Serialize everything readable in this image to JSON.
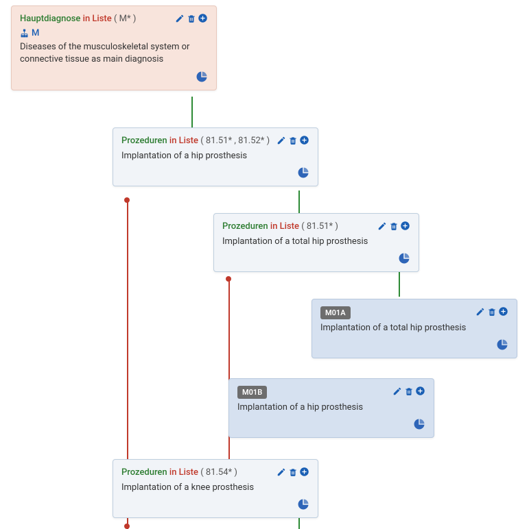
{
  "nodes": {
    "root": {
      "label_green": "Hauptdiagnose",
      "label_red": "in Liste",
      "label_grey": "( M* )",
      "meta_code": "M",
      "desc": "Diseases of the musculoskeletal system or connective tissue as main diagnosis"
    },
    "proc1": {
      "label_green": "Prozeduren",
      "label_red": "in Liste",
      "label_grey": "( 81.51* , 81.52* )",
      "desc": "Implantation of a hip prosthesis"
    },
    "proc2": {
      "label_green": "Prozeduren",
      "label_red": "in Liste",
      "label_grey": "( 81.51* )",
      "desc": "Implantation of a total hip prosthesis"
    },
    "m01a": {
      "badge": "M01A",
      "desc": "Implantation of a total hip prosthesis"
    },
    "m01b": {
      "badge": "M01B",
      "desc": "Implantation of a hip prosthesis"
    },
    "proc3": {
      "label_green": "Prozeduren",
      "label_red": "in Liste",
      "label_grey": "( 81.54* )",
      "desc": "Implantation of a knee prosthesis"
    }
  }
}
